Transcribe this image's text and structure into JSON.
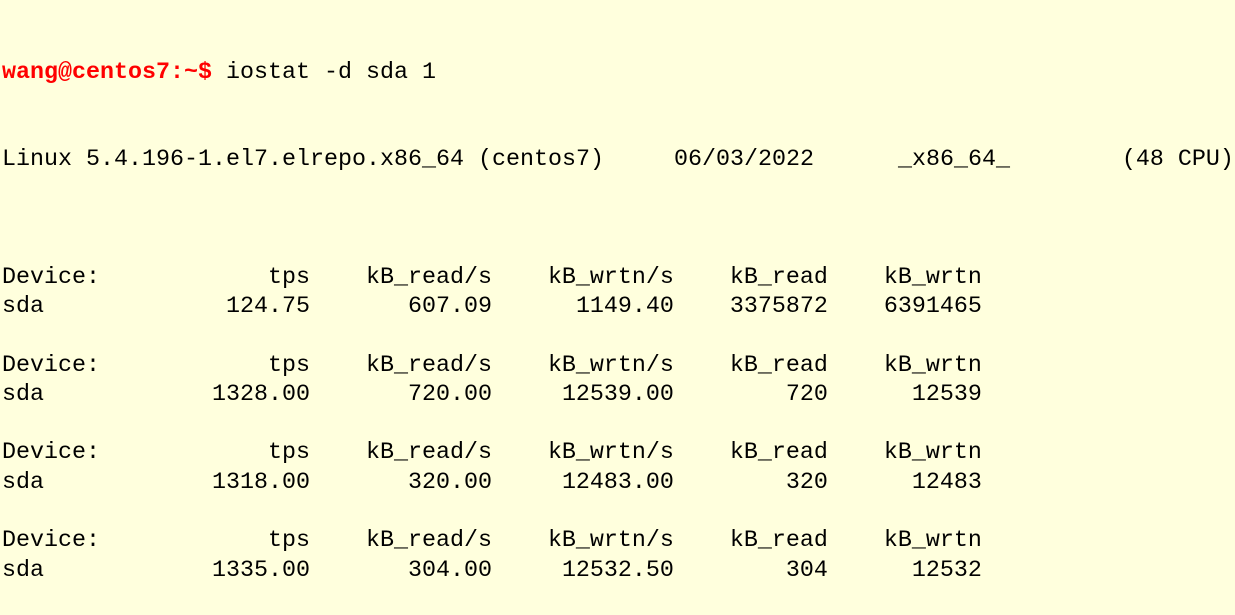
{
  "prompt": "wang@centos7:~$",
  "command": " iostat -d sda 1",
  "sysinfo": "Linux 5.4.196-1.el7.elrepo.x86_64 (centos7)     06/03/2022      _x86_64_        (48 CPU)",
  "headers": [
    "Device:",
    "tps",
    "kB_read/s",
    "kB_wrtn/s",
    "kB_read",
    "kB_wrtn"
  ],
  "reports": [
    [
      "sda",
      "124.75",
      "607.09",
      "1149.40",
      "3375872",
      "6391465"
    ],
    [
      "sda",
      "1328.00",
      "720.00",
      "12539.00",
      "720",
      "12539"
    ],
    [
      "sda",
      "1318.00",
      "320.00",
      "12483.00",
      "320",
      "12483"
    ],
    [
      "sda",
      "1335.00",
      "304.00",
      "12532.50",
      "304",
      "12532"
    ]
  ]
}
